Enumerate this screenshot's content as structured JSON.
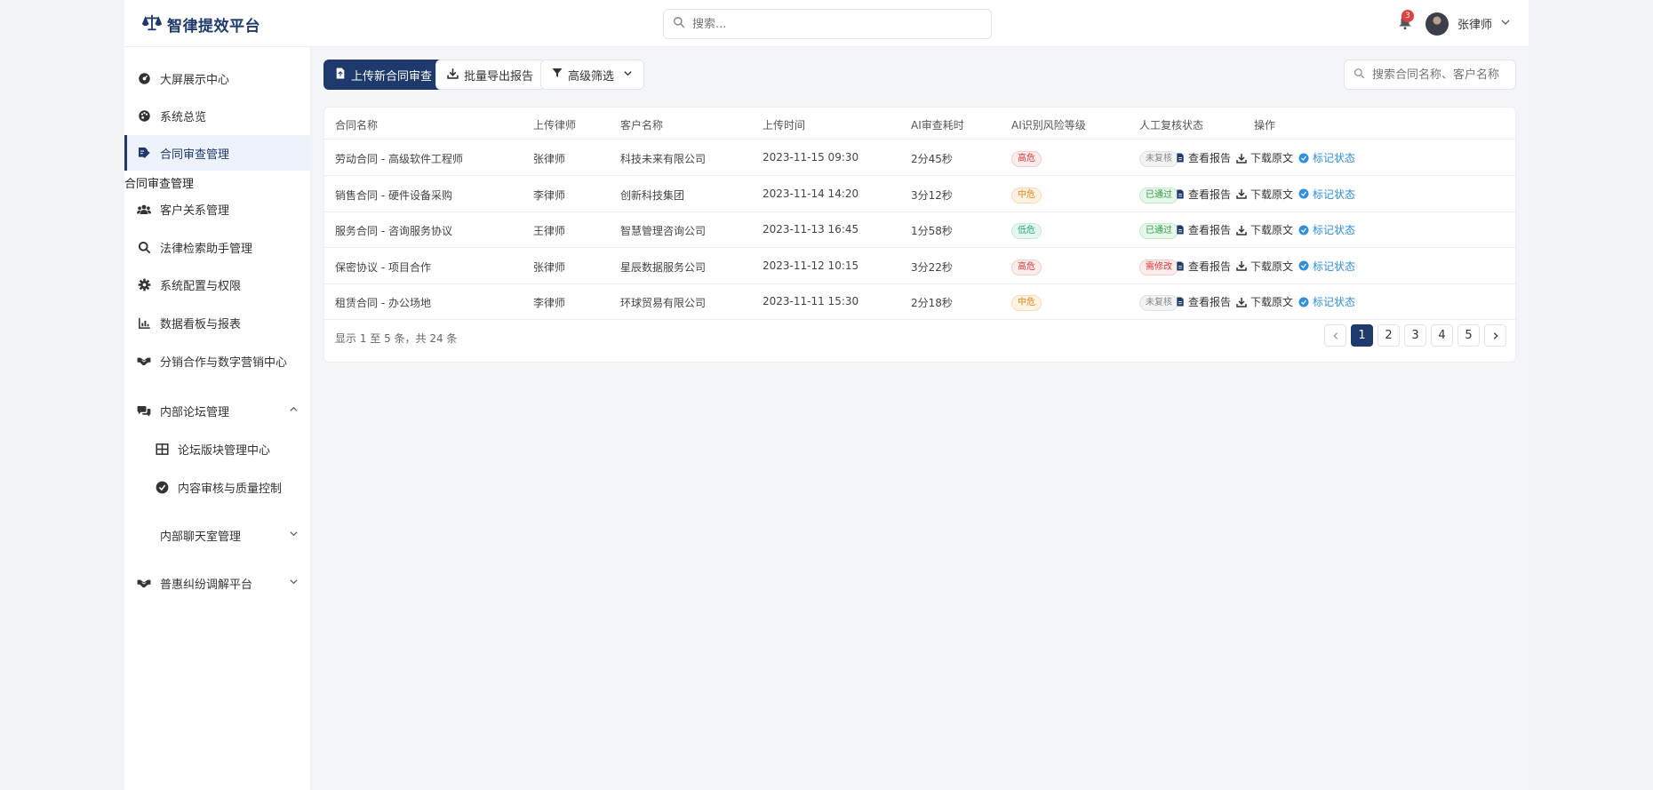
{
  "brand": {
    "name": "智律提效平台"
  },
  "search": {
    "placeholder": "搜索..."
  },
  "notifications": {
    "count": "3"
  },
  "user": {
    "name": "张律师"
  },
  "sidebar": {
    "items": [
      {
        "label": "大屏展示中心",
        "icon": "dashboard-icon"
      },
      {
        "label": "系统总览",
        "icon": "palette-icon"
      },
      {
        "label": "合同审查管理",
        "icon": "contract-edit-icon"
      },
      {
        "label": "客户关系管理",
        "icon": "users-icon"
      },
      {
        "label": "法律检索助手管理",
        "icon": "search-icon"
      },
      {
        "label": "系统配置与权限",
        "icon": "gear-icon"
      },
      {
        "label": "数据看板与报表",
        "icon": "chart-icon"
      },
      {
        "label": "分销合作与数字营销中心",
        "icon": "handshake-icon"
      },
      {
        "label": "内部论坛管理",
        "icon": "comments-icon"
      },
      {
        "label": "论坛版块管理中心",
        "icon": "grid-icon"
      },
      {
        "label": "内容审核与质量控制",
        "icon": "check-circle-icon"
      },
      {
        "label": "内部聊天室管理",
        "icon": ""
      },
      {
        "label": "普惠纠纷调解平台",
        "icon": "handshake-icon"
      }
    ],
    "tooltip": "合同审查管理"
  },
  "toolbar": {
    "upload": "上传新合同审查",
    "export": "批量导出报告",
    "filter": "高级筛选",
    "search_placeholder": "搜索合同名称、客户名称"
  },
  "table": {
    "headers": [
      "合同名称",
      "上传律师",
      "客户名称",
      "上传时间",
      "AI审查耗时",
      "AI识别风险等级",
      "人工复核状态",
      "操作"
    ],
    "rows": [
      {
        "name": "劳动合同 - 高级软件工程师",
        "lawyer": "张律师",
        "client": "科技未来有限公司",
        "time": "2023-11-15 09:30",
        "duration": "2分45秒",
        "risk": "高危",
        "status": "未复核"
      },
      {
        "name": "销售合同 - 硬件设备采购",
        "lawyer": "李律师",
        "client": "创新科技集团",
        "time": "2023-11-14 14:20",
        "duration": "3分12秒",
        "risk": "中危",
        "status": "已通过"
      },
      {
        "name": "服务合同 - 咨询服务协议",
        "lawyer": "王律师",
        "client": "智慧管理咨询公司",
        "time": "2023-11-13 16:45",
        "duration": "1分58秒",
        "risk": "低危",
        "status": "已通过"
      },
      {
        "name": "保密协议 - 项目合作",
        "lawyer": "张律师",
        "client": "星辰数据服务公司",
        "time": "2023-11-12 10:15",
        "duration": "3分22秒",
        "risk": "高危",
        "status": "需修改"
      },
      {
        "name": "租赁合同 - 办公场地",
        "lawyer": "李律师",
        "client": "环球贸易有限公司",
        "time": "2023-11-11 15:30",
        "duration": "2分18秒",
        "risk": "中危",
        "status": "未复核"
      }
    ],
    "actions": {
      "view": "查看报告",
      "download": "下载原文",
      "mark": "标记状态"
    }
  },
  "pagination": {
    "info": "显示 1 至 5 条，共 24 条",
    "pages": [
      "1",
      "2",
      "3",
      "4",
      "5"
    ],
    "current": "1"
  }
}
